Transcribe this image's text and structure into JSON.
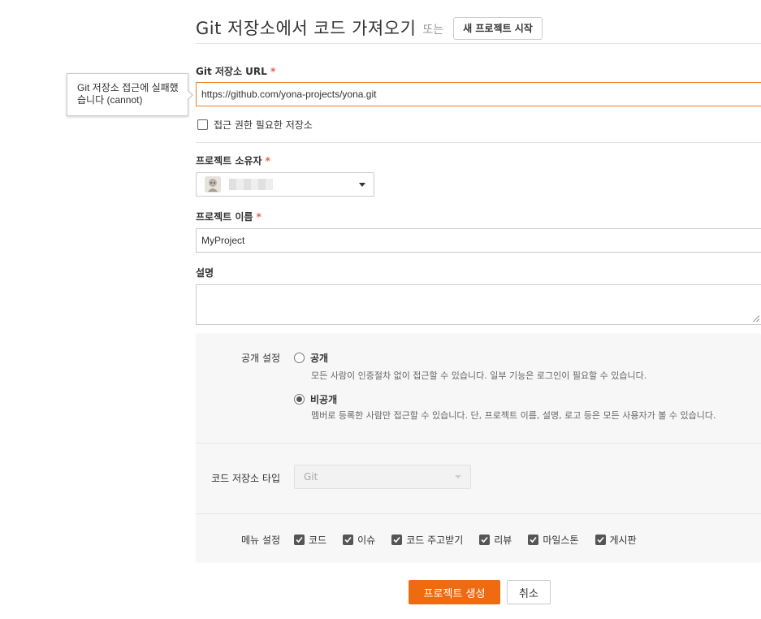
{
  "header": {
    "title": "Git 저장소에서 코드 가져오기",
    "or_text": "또는",
    "new_project_label": "새 프로젝트 시작"
  },
  "git_url": {
    "label": "Git 저장소 URL",
    "required_mark": "*",
    "value": "https://github.com/yona-projects/yona.git",
    "error_tooltip": "Git 저장소 접근에 실패했습니다 (cannot)",
    "private_repo_checkbox_label": "접근 권한 필요한 저장소",
    "private_repo_checked": false
  },
  "owner": {
    "label": "프로젝트 소유자",
    "required_mark": "*",
    "avatar_icon": "user-avatar-icon"
  },
  "project_name": {
    "label": "프로젝트 이름",
    "required_mark": "*",
    "value": "MyProject"
  },
  "description": {
    "label": "설명",
    "value": ""
  },
  "visibility": {
    "label": "공개 설정",
    "options": [
      {
        "label": "공개",
        "description": "모든 사람이 인증절차 없이 접근할 수 있습니다. 일부 기능은 로그인이 필요할 수 있습니다.",
        "selected": false
      },
      {
        "label": "비공개",
        "description": "멤버로 등록한 사람만 접근할 수 있습니다. 단, 프로젝트 이름, 설명, 로고 등은 모든 사용자가 볼 수 있습니다.",
        "selected": true
      }
    ]
  },
  "vcs": {
    "label": "코드 저장소 타입",
    "value": "Git",
    "disabled": true
  },
  "menu_settings": {
    "label": "메뉴 설정",
    "items": [
      {
        "label": "코드",
        "checked": true
      },
      {
        "label": "이슈",
        "checked": true
      },
      {
        "label": "코드 주고받기",
        "checked": true
      },
      {
        "label": "리뷰",
        "checked": true
      },
      {
        "label": "마일스톤",
        "checked": true
      },
      {
        "label": "게시판",
        "checked": true
      }
    ]
  },
  "actions": {
    "create_label": "프로젝트 생성",
    "cancel_label": "취소"
  },
  "colors": {
    "primary": "#ee6b12",
    "required": "#e8604c",
    "error_border": "#e87e2c"
  }
}
